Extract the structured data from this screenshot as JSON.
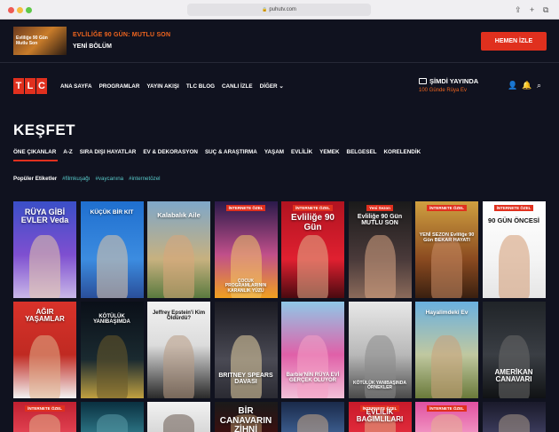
{
  "browser": {
    "url": "puhutv.com"
  },
  "promo": {
    "title": "EVLİLİĞE 90 GÜN: MUTLU SON",
    "subtitle": "YENİ BÖLÜM",
    "button": "HEMEN İZLE",
    "thumb_text": "Evliliğe 90 Gün Mutlu Son"
  },
  "nav": {
    "logo": [
      "T",
      "L",
      "C"
    ],
    "links": [
      "ANA SAYFA",
      "PROGRAMLAR",
      "YAYIN AKIŞI",
      "TLC BLOG",
      "CANLI İZLE",
      "DİĞER"
    ],
    "live_title": "ŞİMDİ YAYINDA",
    "live_sub": "100 Günde Rüya Ev"
  },
  "page": {
    "title": "KEŞFET"
  },
  "categories": [
    "ÖNE ÇIKANLAR",
    "A-Z",
    "SIRA DIŞI HAYATLAR",
    "EV & DEKORASYON",
    "SUÇ & ARAŞTIRMA",
    "YAŞAM",
    "EVLİLİK",
    "YEMEK",
    "BELGESEL",
    "KORELENDİK"
  ],
  "tags": {
    "label": "Popüler Etiketler",
    "items": [
      "#filmkuşağı",
      "#vaycanına",
      "#internetözel"
    ]
  },
  "colors": {
    "accent": "#e0301e",
    "orange": "#f0651e",
    "teal": "#58c8c8",
    "bg": "#10121f"
  },
  "row1": [
    {
      "title": "RÜYA GİBİ EVLER Veda",
      "badge": ""
    },
    {
      "title": "KÜÇÜK BİR KIT",
      "badge": ""
    },
    {
      "title": "Kalabalık Aile",
      "badge": ""
    },
    {
      "title": "ÇOCUK PROGRAMLARININ KARANLIK YÜZÜ",
      "badge": "İNTERNETE ÖZEL"
    },
    {
      "title": "Evliliğe 90 Gün",
      "badge": "İNTERNETE ÖZEL"
    },
    {
      "title": "Evliliğe 90 Gün MUTLU SON",
      "badge": "Yeni Sezon"
    },
    {
      "title": "YENİ SEZON Evliliğe 90 Gün BEKAR HAYATI",
      "badge": "İNTERNETE ÖZEL"
    },
    {
      "title": "90 GÜN ÖNCESİ",
      "badge": "İNTERNETE ÖZEL"
    }
  ],
  "row2": [
    {
      "title": "AĞIR YAŞAMLAR",
      "badge": ""
    },
    {
      "title": "KÖTÜLÜK YANIBAŞIMDA",
      "badge": ""
    },
    {
      "title": "Jeffrey Epstein'i Kim Öldürdü?",
      "badge": ""
    },
    {
      "title": "BRITNEY SPEARS DAVASI",
      "badge": ""
    },
    {
      "title": "Barbie'NİN RÜYA EVİ GERÇEK OLUYOR",
      "badge": ""
    },
    {
      "title": "KÖTÜLÜK YANIBAŞINDA ÖRNEKLER",
      "badge": ""
    },
    {
      "title": "Hayalimdeki Ev",
      "badge": ""
    },
    {
      "title": "AMERİKAN CANAVARI",
      "badge": ""
    }
  ],
  "row3": [
    {
      "title": "",
      "badge": "İNTERNETE ÖZEL"
    },
    {
      "title": "",
      "badge": ""
    },
    {
      "title": "",
      "badge": ""
    },
    {
      "title": "BİR CANAVARIN ZİHNİ DAHMER",
      "badge": ""
    },
    {
      "title": "",
      "badge": ""
    },
    {
      "title": "EVLİLİK BAĞIMLILARI",
      "badge": "İNTERNETE ÖZEL"
    },
    {
      "title": "",
      "badge": "İNTERNETE ÖZEL"
    },
    {
      "title": "",
      "badge": ""
    }
  ]
}
